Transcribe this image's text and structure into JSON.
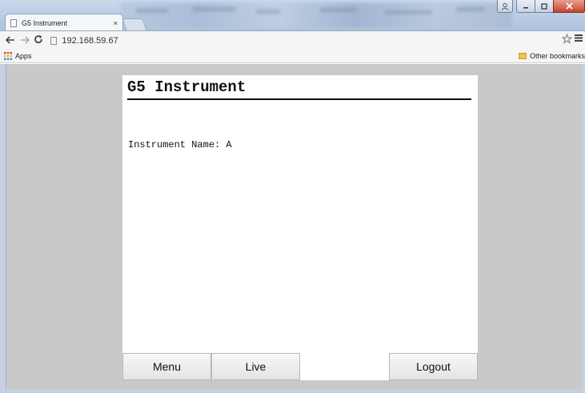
{
  "browser": {
    "tab_title": "G5 Instrument",
    "tab_close": "×",
    "url": "192.168.59.67",
    "bookmarks": {
      "apps_label": "Apps",
      "other_label": "Other bookmarks"
    },
    "icons": {
      "back": "back-arrow-icon",
      "forward": "forward-arrow-icon",
      "reload": "reload-icon",
      "star": "star-icon",
      "menu": "hamburger-menu-icon"
    }
  },
  "page": {
    "title": "G5 Instrument",
    "instrument_name_label": "Instrument Name: ",
    "instrument_name_value": "A",
    "buttons": {
      "menu": "Menu",
      "live": "Live",
      "logout": "Logout"
    }
  }
}
